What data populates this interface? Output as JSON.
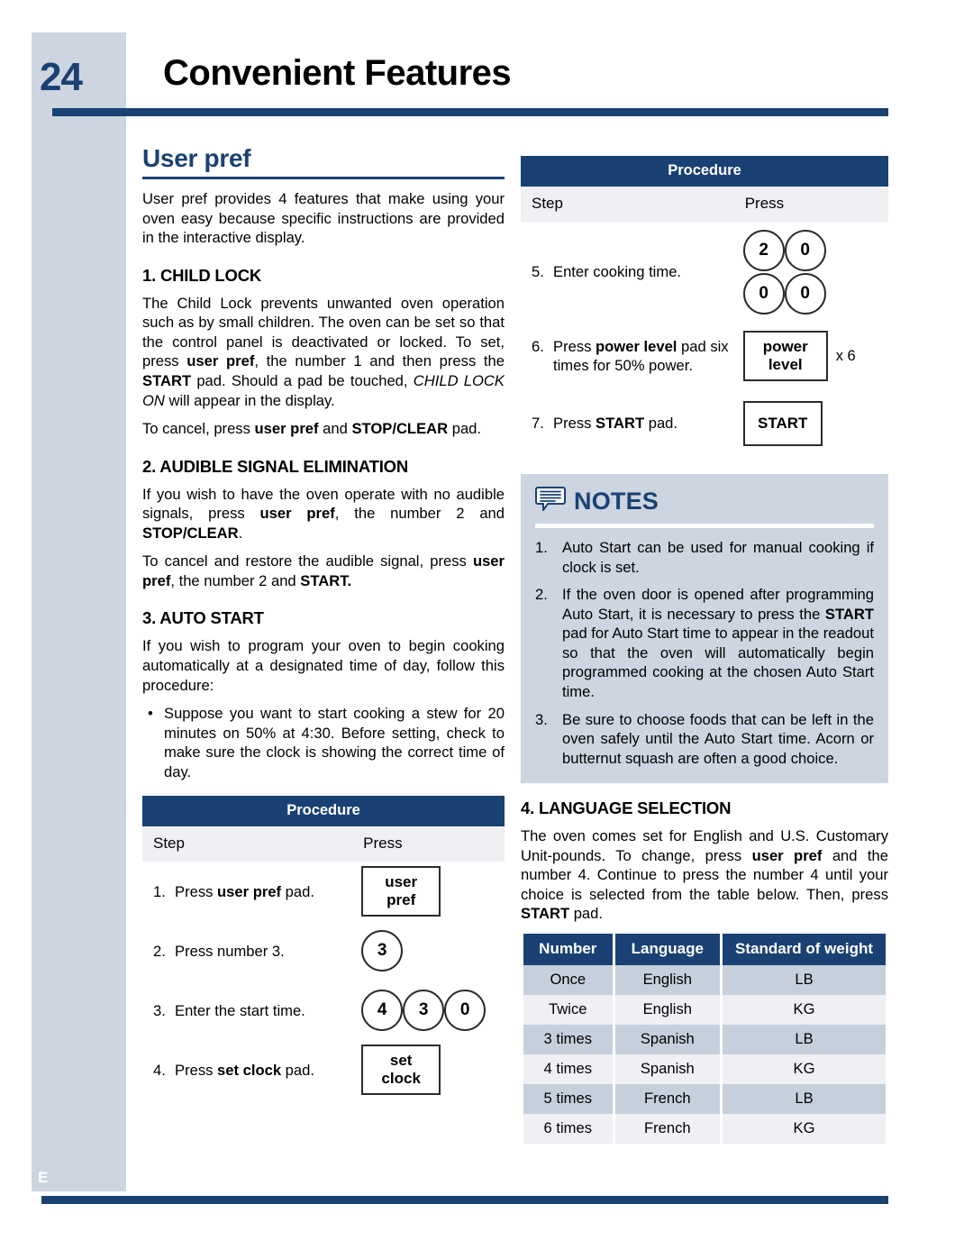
{
  "header": {
    "page_number": "24",
    "title": "Convenient Features",
    "side_letter": "E"
  },
  "left": {
    "section_title": "User pref",
    "intro": "User pref provides 4 features that make using your oven easy because specific instructions are provided in the interactive display.",
    "child_lock": {
      "heading": "1. CHILD LOCK",
      "para1_a": "The Child Lock prevents unwanted oven operation such as by small children. The oven can be set so that the control panel is deactivated or locked. To set, press ",
      "bold1": "user pref",
      "para1_b": ", the number 1 and then press the ",
      "bold2": "START",
      "para1_c": " pad. Should a pad be touched, ",
      "italic1": "CHILD LOCK ON",
      "para1_d": " will appear in the display.",
      "para2_a": "To cancel, press ",
      "bold3": "user pref",
      "para2_b": " and ",
      "bold4": "STOP/CLEAR",
      "para2_c": " pad."
    },
    "audible": {
      "heading": "2. AUDIBLE SIGNAL ELIMINATION",
      "para1_a": "If you wish to have the oven operate with no audible signals, press ",
      "bold1": "user pref",
      "para1_b": ", the number 2 and ",
      "bold2": "STOP/CLEAR",
      "para1_c": ".",
      "para2_a": "To cancel and restore the audible signal, press ",
      "bold3": "user pref",
      "para2_b": ", the number 2 and ",
      "bold4": "START."
    },
    "auto_start": {
      "heading": "3. AUTO START",
      "para1": "If you wish to program your oven to begin cooking automatically at a designated time of day, follow this procedure:",
      "bullet_marker": "•",
      "bullet": "Suppose you want to start cooking a stew for 20 minutes on 50% at 4:30. Before setting, check to make sure the clock is showing the correct time of day."
    },
    "procedure": {
      "title": "Procedure",
      "col_step": "Step",
      "col_press": "Press",
      "rows": [
        {
          "num": "1.",
          "text_a": "Press ",
          "bold": "user pref",
          "text_b": " pad.",
          "pad_type": "box",
          "pad_lines": [
            "user",
            "pref"
          ]
        },
        {
          "num": "2.",
          "text_a": "Press number 3.",
          "bold": "",
          "text_b": "",
          "pad_type": "circles",
          "pad_circles": [
            "3"
          ]
        },
        {
          "num": "3.",
          "text_a": "Enter the start time.",
          "bold": "",
          "text_b": "",
          "pad_type": "circles",
          "pad_circles": [
            "4",
            "3",
            "0"
          ]
        },
        {
          "num": "4.",
          "text_a": "Press ",
          "bold": "set clock",
          "text_b": " pad.",
          "pad_type": "box",
          "pad_lines": [
            "set",
            "clock"
          ]
        }
      ]
    }
  },
  "right": {
    "procedure": {
      "title": "Procedure",
      "col_step": "Step",
      "col_press": "Press",
      "rows": [
        {
          "num": "5.",
          "text_a": "Enter cooking time.",
          "bold": "",
          "text_b": "",
          "pad_type": "circle-grid",
          "pad_rows": [
            [
              "2",
              "0"
            ],
            [
              "0",
              "0"
            ]
          ]
        },
        {
          "num": "6.",
          "text_a": "Press ",
          "bold": "power level",
          "text_b": " pad six times for 50% power.",
          "pad_type": "box",
          "pad_lines": [
            "power",
            "level"
          ],
          "suffix": "x 6"
        },
        {
          "num": "7.",
          "text_a": "Press ",
          "bold": "START",
          "text_b": " pad.",
          "pad_type": "box",
          "pad_lines": [
            "START"
          ]
        }
      ]
    },
    "notes": {
      "icon": "notes-speech-bubble-icon",
      "title": "NOTES",
      "items": [
        {
          "num": "1.",
          "text_a": "Auto Start can be used for manual cooking if clock is set.",
          "bold": "",
          "text_b": ""
        },
        {
          "num": "2.",
          "text_a": "If the oven door is opened after programming Auto Start, it is necessary to press the ",
          "bold": "START",
          "text_b": " pad for Auto Start time to appear in the readout so that the oven will automatically begin programmed cooking at the chosen Auto Start time."
        },
        {
          "num": "3.",
          "text_a": "Be sure to choose foods that can be left in the oven safely until the Auto Start time. Acorn or butternut squash are often a good choice.",
          "bold": "",
          "text_b": ""
        }
      ]
    },
    "language": {
      "heading": "4. LANGUAGE SELECTION",
      "para_a": "The oven comes set for English and U.S. Customary Unit-pounds. To change, press ",
      "bold1": "user pref",
      "para_b": " and the number 4. Continue to press the number 4 until your choice is selected from the table below. Then,  press ",
      "bold2": "START",
      "para_c": " pad.",
      "columns": [
        "Number",
        "Language",
        "Standard of weight"
      ],
      "rows": [
        [
          "Once",
          "English",
          "LB"
        ],
        [
          "Twice",
          "English",
          "KG"
        ],
        [
          "3 times",
          "Spanish",
          "LB"
        ],
        [
          "4 times",
          "Spanish",
          "KG"
        ],
        [
          "5 times",
          "French",
          "LB"
        ],
        [
          "6 times",
          "French",
          "KG"
        ]
      ]
    }
  },
  "colors": {
    "navy": "#1a4173",
    "sidebar_gray": "#ccd5e0",
    "row_light": "#eef0f4",
    "row_dark": "#c6d0dc"
  }
}
